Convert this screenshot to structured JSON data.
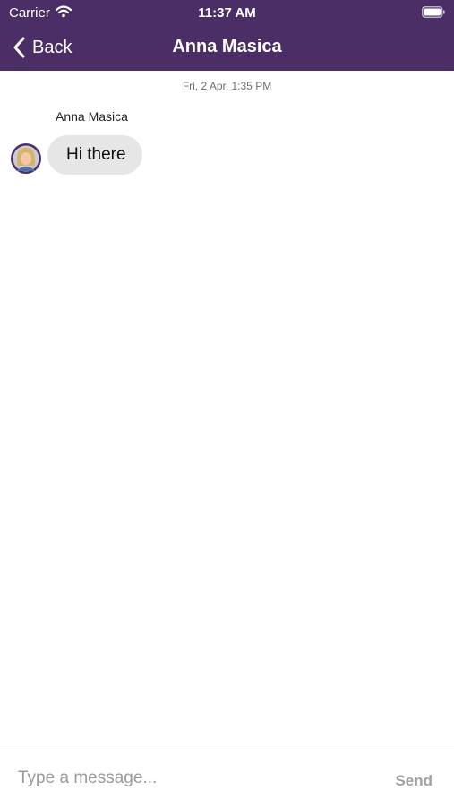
{
  "status_bar": {
    "carrier": "Carrier",
    "time": "11:37 AM",
    "wifi_icon": "wifi-icon",
    "battery_icon": "battery-icon"
  },
  "nav": {
    "back_label": "Back",
    "back_icon": "chevron-left-icon",
    "title": "Anna Masica"
  },
  "conversation": {
    "date_header": "Fri, 2 Apr, 1:35 PM",
    "messages": [
      {
        "sender": "Anna Masica",
        "text": "Hi there",
        "avatar_icon": "avatar"
      }
    ]
  },
  "composer": {
    "placeholder": "Type a message...",
    "value": "",
    "send_label": "Send"
  },
  "colors": {
    "header_bg": "#4b2e66",
    "bubble_bg": "#e6e6e6",
    "send_disabled": "#a0a0a0"
  }
}
